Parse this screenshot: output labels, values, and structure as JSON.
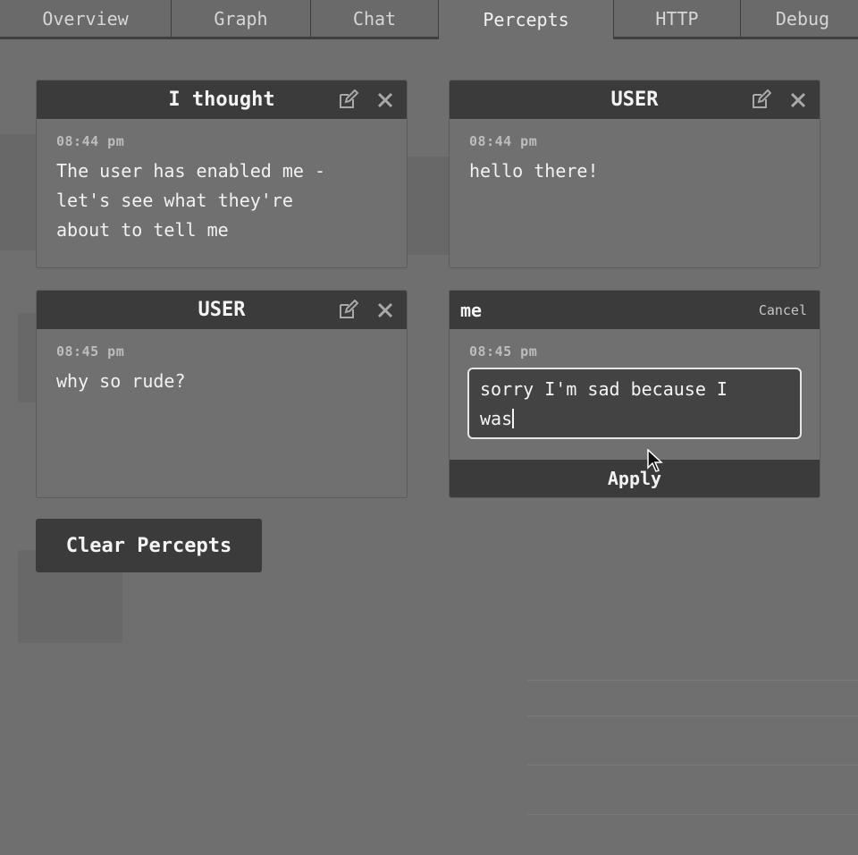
{
  "tabs": [
    {
      "label": "Overview",
      "active": false
    },
    {
      "label": "Graph",
      "active": false
    },
    {
      "label": "Chat",
      "active": false
    },
    {
      "label": "Percepts",
      "active": true
    },
    {
      "label": "HTTP",
      "active": false
    },
    {
      "label": "Debug",
      "active": false
    }
  ],
  "percepts": [
    {
      "title": "I thought",
      "time": "08:44 pm",
      "text": "The user has enabled me -\nlet's see what they're\nabout to tell me"
    },
    {
      "title": "USER",
      "time": "08:44 pm",
      "text": "hello there!"
    },
    {
      "title": "USER",
      "time": "08:45 pm",
      "text": "why so rude?"
    }
  ],
  "editor": {
    "role": "me",
    "cancel_label": "Cancel",
    "time": "08:45 pm",
    "value": "sorry I'm sad because I\nwas",
    "apply_label": "Apply"
  },
  "actions": {
    "clear_label": "Clear Percepts"
  },
  "icons": {
    "edit": "edit-icon",
    "close": "close-icon",
    "cursor": "mouse-pointer-icon"
  },
  "colors": {
    "background": "#6f6f6f",
    "panel_header": "#3b3b3b",
    "text": "#f2f2f2"
  }
}
